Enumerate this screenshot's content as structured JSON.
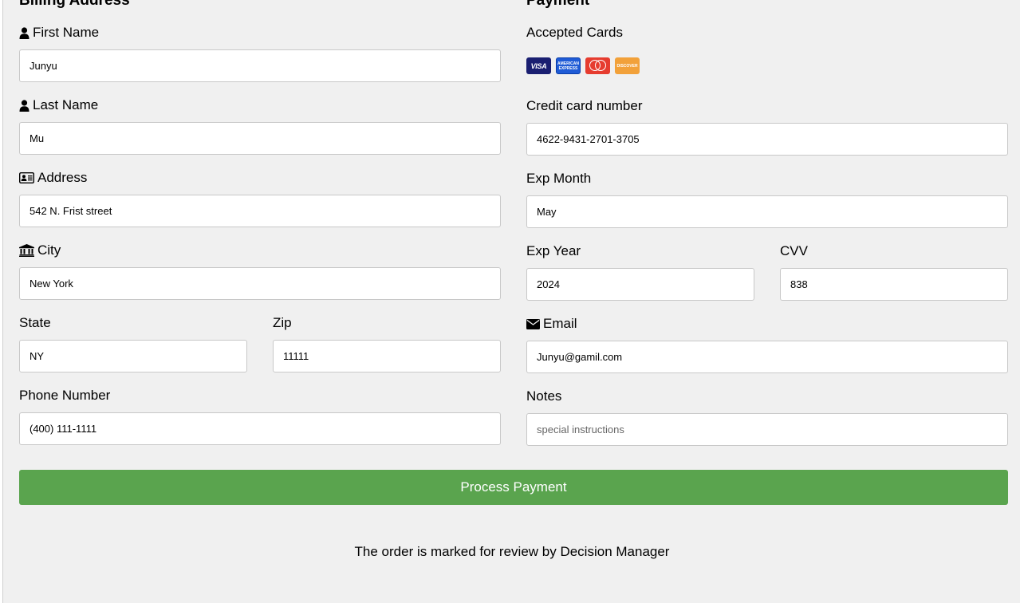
{
  "billing": {
    "title": "Billing Address",
    "first_name": {
      "label": "First Name",
      "value": "Junyu",
      "icon": "user-icon"
    },
    "last_name": {
      "label": "Last Name",
      "value": "Mu",
      "icon": "user-icon"
    },
    "address": {
      "label": "Address",
      "value": "542 N. Frist street",
      "icon": "address-card-icon"
    },
    "city": {
      "label": "City",
      "value": "New York",
      "icon": "institution-icon"
    },
    "state": {
      "label": "State",
      "value": "NY"
    },
    "zip": {
      "label": "Zip",
      "value": "11111"
    },
    "phone": {
      "label": "Phone Number",
      "value": "(400) 111-1111"
    }
  },
  "payment": {
    "title": "Payment",
    "accepted_cards_label": "Accepted Cards",
    "cards": [
      "visa",
      "amex",
      "mastercard",
      "discover"
    ],
    "card_number": {
      "label": "Credit card number",
      "value": "4622-9431-2701-3705"
    },
    "exp_month": {
      "label": "Exp Month",
      "value": "May"
    },
    "exp_year": {
      "label": "Exp Year",
      "value": "2024"
    },
    "cvv": {
      "label": "CVV",
      "value": "838"
    },
    "email": {
      "label": "Email",
      "value": "Junyu@gamil.com",
      "icon": "envelope-icon"
    },
    "notes": {
      "label": "Notes",
      "placeholder": "special instructions",
      "value": ""
    }
  },
  "submit_label": "Process Payment",
  "status_message": "The order is marked for review by Decision Manager",
  "colors": {
    "button": "#5aa44e",
    "background": "#f0f0f0"
  }
}
